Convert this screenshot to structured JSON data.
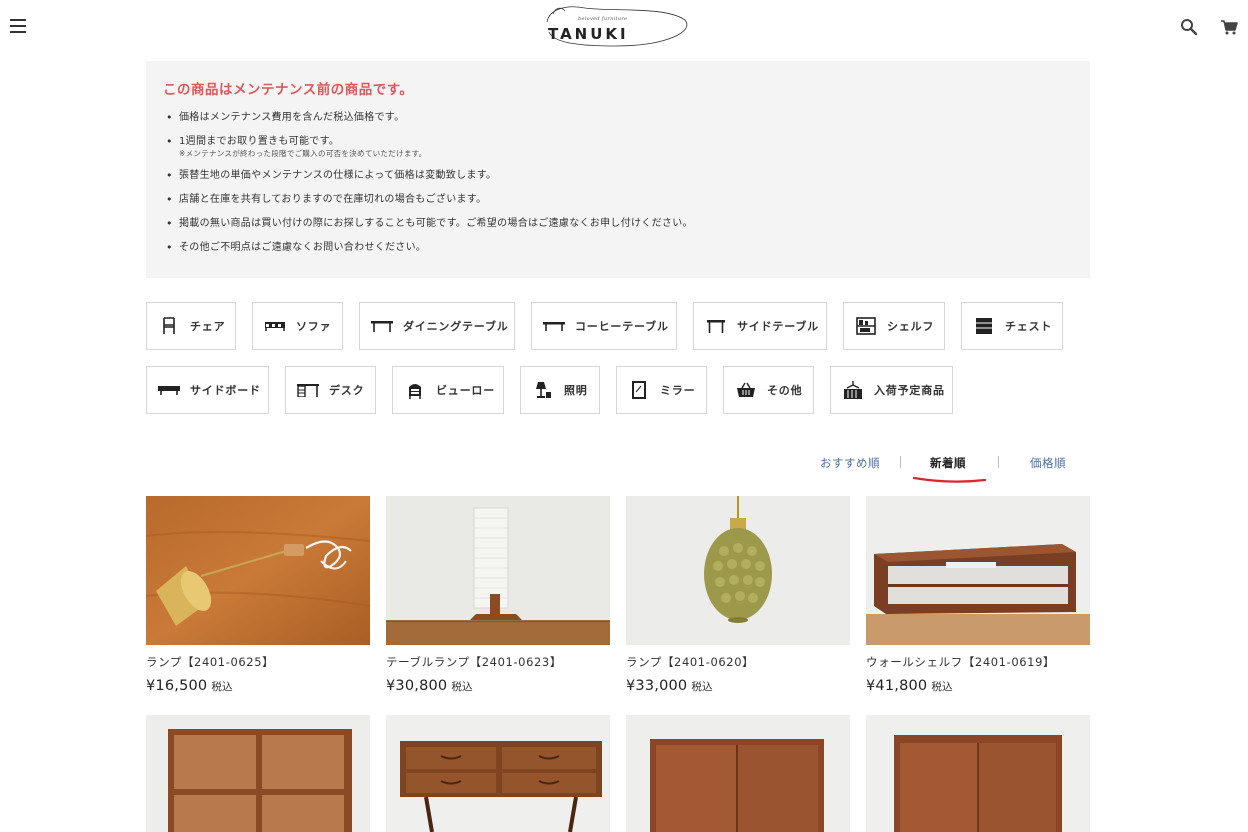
{
  "header": {
    "logo_tagline": "beloved furniture",
    "logo_brand": "TANUKI"
  },
  "notice": {
    "title": "この商品はメンテナンス前の商品です。",
    "items": [
      {
        "text": "価格はメンテナンス費用を含んだ税込価格です。",
        "subnote": ""
      },
      {
        "text": "1週間までお取り置きも可能です。",
        "subnote": "※メンテナンスが終わった段階でご購入の可否を決めていただけます。"
      },
      {
        "text": "張替生地の単価やメンテナンスの仕様によって価格は変動致します。",
        "subnote": ""
      },
      {
        "text": "店舗と在庫を共有しておりますので在庫切れの場合もございます。",
        "subnote": ""
      },
      {
        "text": "掲載の無い商品は買い付けの際にお探しすることも可能です。ご希望の場合はご遠慮なくお申し付けください。",
        "subnote": ""
      },
      {
        "text": "その他ご不明点はご遠慮なくお問い合わせください。",
        "subnote": ""
      }
    ]
  },
  "categories": [
    {
      "label": "チェア",
      "icon": "chair-icon"
    },
    {
      "label": "ソファ",
      "icon": "sofa-icon"
    },
    {
      "label": "ダイニングテーブル",
      "icon": "dining-table-icon"
    },
    {
      "label": "コーヒーテーブル",
      "icon": "coffee-table-icon"
    },
    {
      "label": "サイドテーブル",
      "icon": "side-table-icon"
    },
    {
      "label": "シェルフ",
      "icon": "shelf-icon"
    },
    {
      "label": "チェスト",
      "icon": "chest-icon"
    },
    {
      "label": "サイドボード",
      "icon": "sideboard-icon"
    },
    {
      "label": "デスク",
      "icon": "desk-icon"
    },
    {
      "label": "ビューロー",
      "icon": "bureau-icon"
    },
    {
      "label": "照明",
      "icon": "lamp-icon"
    },
    {
      "label": "ミラー",
      "icon": "mirror-icon"
    },
    {
      "label": "その他",
      "icon": "basket-icon"
    },
    {
      "label": "入荷予定商品",
      "icon": "incoming-icon"
    }
  ],
  "sort": {
    "options": [
      "おすすめ順",
      "新着順",
      "価格順"
    ],
    "selected": "新着順",
    "underline_color": "#d9272e"
  },
  "products": [
    {
      "name": "ランプ【2401-0625】",
      "price": "¥16,500",
      "tax": "税込"
    },
    {
      "name": "テーブルランプ【2401-0623】",
      "price": "¥30,800",
      "tax": "税込"
    },
    {
      "name": "ランプ【2401-0620】",
      "price": "¥33,000",
      "tax": "税込"
    },
    {
      "name": "ウォールシェルフ【2401-0619】",
      "price": "¥41,800",
      "tax": "税込"
    }
  ],
  "colors": {
    "accent_red": "#e0565a",
    "link_blue": "#4a6fa5",
    "notice_bg": "#f4f4f4"
  }
}
